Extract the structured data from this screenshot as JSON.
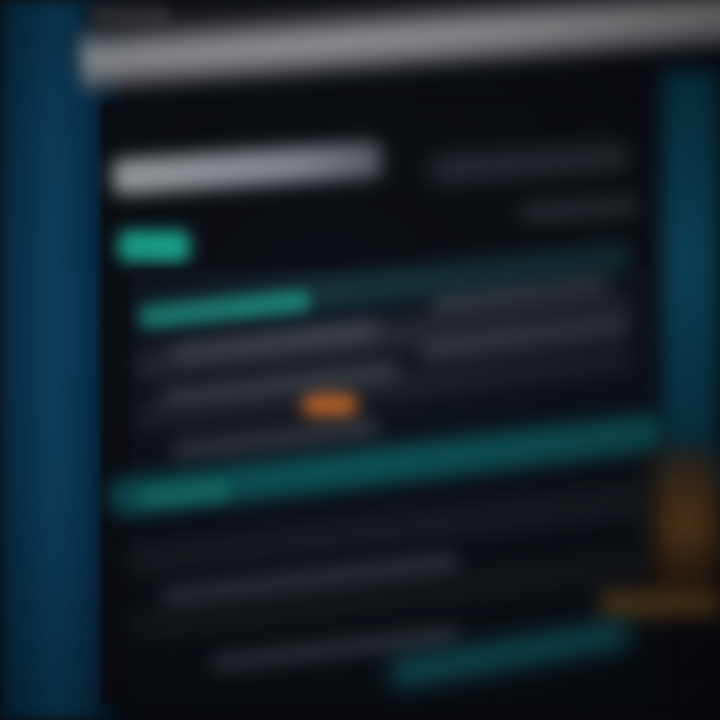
{
  "scene": {
    "is_blurred": true,
    "accent_colors": {
      "teal": "#1fbfa6",
      "blue": "#0f4e72",
      "orange": "#c86a2b",
      "light_gray": "#c9c9cc"
    }
  },
  "window": {
    "title": "",
    "selected_tab": ""
  },
  "table": {
    "rows": [
      {
        "primary": "",
        "secondary": ""
      },
      {
        "primary": "",
        "secondary": ""
      },
      {
        "primary": "",
        "secondary": ""
      },
      {
        "primary": "",
        "secondary": ""
      },
      {
        "primary": "",
        "secondary": ""
      },
      {
        "primary": "",
        "secondary": ""
      }
    ]
  }
}
